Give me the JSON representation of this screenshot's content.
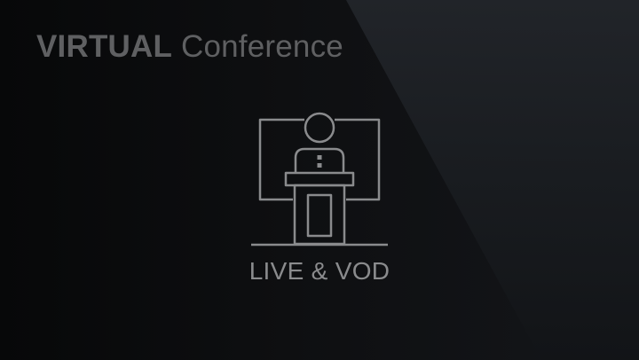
{
  "banner": {
    "title_bold": "VIRTUAL",
    "title_rest": "Conference",
    "caption": "LIVE & VOD",
    "icon": "speaker-at-podium-icon",
    "colors": {
      "background": "#0d0e10",
      "title": "#5f6062",
      "icon_stroke": "#8a8b8d",
      "caption": "#8a8b8d"
    }
  }
}
